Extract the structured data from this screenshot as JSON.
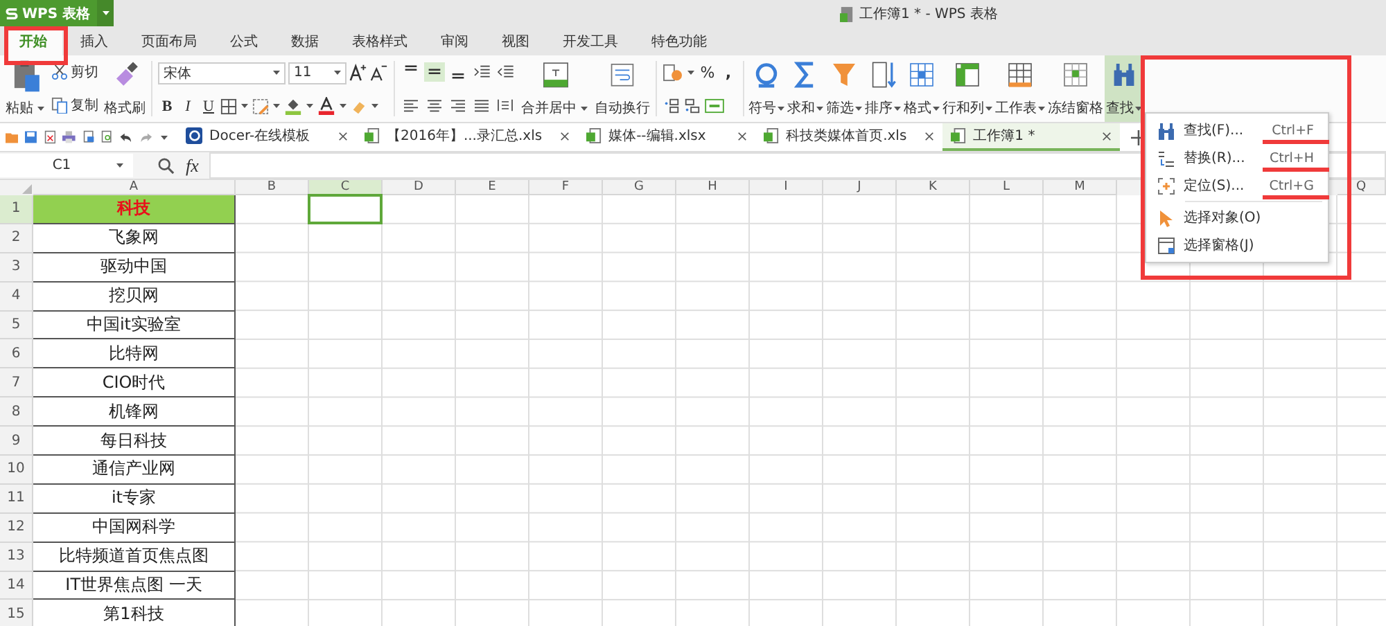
{
  "app_button": {
    "label": "WPS 表格"
  },
  "window": {
    "title": "工作簿1 * - WPS 表格"
  },
  "tabs": [
    {
      "label": "开始",
      "selected": true,
      "annotated": true
    },
    {
      "label": "插入",
      "selected": false,
      "annotated": false
    },
    {
      "label": "页面布局",
      "selected": false,
      "annotated": false
    },
    {
      "label": "公式",
      "selected": false,
      "annotated": false
    },
    {
      "label": "数据",
      "selected": false,
      "annotated": false
    },
    {
      "label": "表格样式",
      "selected": false,
      "annotated": false
    },
    {
      "label": "审阅",
      "selected": false,
      "annotated": false
    },
    {
      "label": "视图",
      "selected": false,
      "annotated": false
    },
    {
      "label": "开发工具",
      "selected": false,
      "annotated": false
    },
    {
      "label": "特色功能",
      "selected": false,
      "annotated": false
    }
  ],
  "ribbon": {
    "clipboard": {
      "paste": "粘贴",
      "cut": "剪切",
      "copy": "复制",
      "format_painter": "格式刷"
    },
    "font": {
      "name": "宋体",
      "size": "11",
      "bold": "B",
      "italic": "I",
      "underline": "U"
    },
    "alignment": {
      "merge": "合并居中",
      "wrap": "自动换行"
    },
    "number": {
      "percent": "%",
      "thousands": ","
    },
    "tools": [
      {
        "label": "符号",
        "kind": "symbol",
        "selected": false
      },
      {
        "label": "求和",
        "kind": "sum",
        "selected": false
      },
      {
        "label": "筛选",
        "kind": "filter",
        "selected": false
      },
      {
        "label": "排序",
        "kind": "sort",
        "selected": false
      },
      {
        "label": "格式",
        "kind": "format",
        "selected": false
      },
      {
        "label": "行和列",
        "kind": "rowcol",
        "selected": false
      },
      {
        "label": "工作表",
        "kind": "sheet",
        "selected": false
      },
      {
        "label": "冻结窗格",
        "kind": "freeze",
        "selected": false
      },
      {
        "label": "查找",
        "kind": "find",
        "selected": true
      }
    ]
  },
  "doc_tabs": [
    {
      "label": "Docer-在线模板",
      "kind": "docer",
      "selected": false
    },
    {
      "label": "【2016年】...录汇总.xls",
      "kind": "sheet",
      "selected": false
    },
    {
      "label": "媒体--编辑.xlsx",
      "kind": "sheet",
      "selected": false
    },
    {
      "label": "科技类媒体首页.xls",
      "kind": "sheet",
      "selected": false
    },
    {
      "label": "工作簿1 *",
      "kind": "sheet",
      "selected": true
    }
  ],
  "formula_bar": {
    "name_box": "C1",
    "function_label": "fx"
  },
  "sheet": {
    "columns": [
      {
        "label": "A",
        "selected": false
      },
      {
        "label": "B",
        "selected": false
      },
      {
        "label": "C",
        "selected": true
      },
      {
        "label": "D",
        "selected": false
      },
      {
        "label": "E",
        "selected": false
      },
      {
        "label": "F",
        "selected": false
      },
      {
        "label": "G",
        "selected": false
      },
      {
        "label": "H",
        "selected": false
      },
      {
        "label": "I",
        "selected": false
      },
      {
        "label": "J",
        "selected": false
      },
      {
        "label": "K",
        "selected": false
      },
      {
        "label": "L",
        "selected": false
      },
      {
        "label": "M",
        "selected": false
      },
      {
        "label": "Q",
        "selected": false
      }
    ],
    "rows": [
      {
        "number": "1",
        "cell": "科技",
        "kind": "header",
        "selected": true
      },
      {
        "number": "2",
        "cell": "飞象网",
        "kind": "data",
        "selected": false
      },
      {
        "number": "3",
        "cell": "驱动中国",
        "kind": "data",
        "selected": false
      },
      {
        "number": "4",
        "cell": "挖贝网",
        "kind": "data",
        "selected": false
      },
      {
        "number": "5",
        "cell": "中国it实验室",
        "kind": "data",
        "selected": false
      },
      {
        "number": "6",
        "cell": "比特网",
        "kind": "data",
        "selected": false
      },
      {
        "number": "7",
        "cell": "CIO时代",
        "kind": "data",
        "selected": false
      },
      {
        "number": "8",
        "cell": "机锋网",
        "kind": "data",
        "selected": false
      },
      {
        "number": "9",
        "cell": "每日科技",
        "kind": "data",
        "selected": false
      },
      {
        "number": "10",
        "cell": "通信产业网",
        "kind": "data",
        "selected": false
      },
      {
        "number": "11",
        "cell": "it专家",
        "kind": "data",
        "selected": false
      },
      {
        "number": "12",
        "cell": "中国网科学",
        "kind": "data",
        "selected": false
      },
      {
        "number": "13",
        "cell": "比特频道首页焦点图",
        "kind": "data",
        "selected": false
      },
      {
        "number": "14",
        "cell": "IT世界焦点图 一天",
        "kind": "data",
        "selected": false
      },
      {
        "number": "15",
        "cell": "第1科技",
        "kind": "data",
        "selected": false
      }
    ]
  },
  "find_menu": {
    "annotated": true,
    "items": [
      {
        "label": "查找(F)...",
        "shortcut": "Ctrl+F",
        "kind": "find",
        "divider_above": false,
        "underlined": true
      },
      {
        "label": "替换(R)...",
        "shortcut": "Ctrl+H",
        "kind": "replace",
        "divider_above": false,
        "underlined": true
      },
      {
        "label": "定位(S)...",
        "shortcut": "Ctrl+G",
        "kind": "goto",
        "divider_above": false,
        "underlined": true
      },
      {
        "label": "选择对象(O)",
        "kind": "select_object",
        "divider_above": true,
        "underlined": false
      },
      {
        "label": "选择窗格(J)",
        "kind": "select_pane",
        "divider_above": false,
        "underlined": false
      }
    ]
  }
}
